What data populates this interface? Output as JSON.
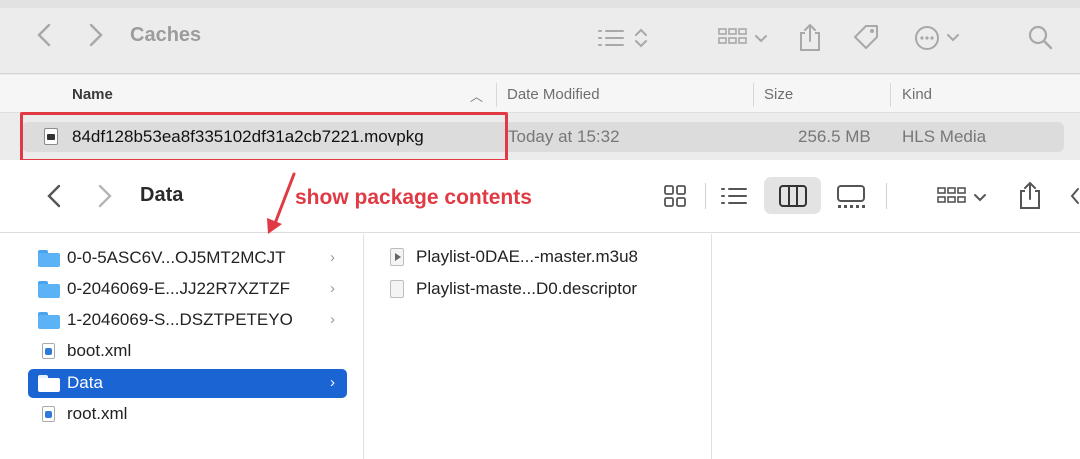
{
  "back_window": {
    "title": "Caches",
    "columns": {
      "name": "Name",
      "date_modified": "Date Modified",
      "size": "Size",
      "kind": "Kind"
    },
    "selected_row": {
      "name": "84df128b53ea8f335102df31a2cb7221.movpkg",
      "date": "Today at 15:32",
      "size": "256.5 MB",
      "kind": "HLS Media"
    }
  },
  "annotation": {
    "text": "show package contents",
    "color": "#e03a44"
  },
  "front_window": {
    "title": "Data",
    "sidebar_items": [
      {
        "label": "0-0-5ASC6V...OJ5MT2MCJT",
        "type": "folder",
        "chevron": "›"
      },
      {
        "label": "0-2046069-E...JJ22R7XZTZF",
        "type": "folder",
        "chevron": "›"
      },
      {
        "label": "1-2046069-S...DSZTPETEYO",
        "type": "folder",
        "chevron": "›"
      },
      {
        "label": "boot.xml",
        "type": "xml-file",
        "chevron": ""
      },
      {
        "label": "Data",
        "type": "folder",
        "chevron": "›",
        "selected": true
      },
      {
        "label": "root.xml",
        "type": "xml-file",
        "chevron": ""
      }
    ],
    "content_items": [
      {
        "label": "Playlist-0DAE...-master.m3u8",
        "type": "m3u8-file"
      },
      {
        "label": "Playlist-maste...D0.descriptor",
        "type": "descriptor-file"
      }
    ]
  },
  "colors": {
    "accent": "#1a64d4",
    "highlight": "#e03a44"
  }
}
